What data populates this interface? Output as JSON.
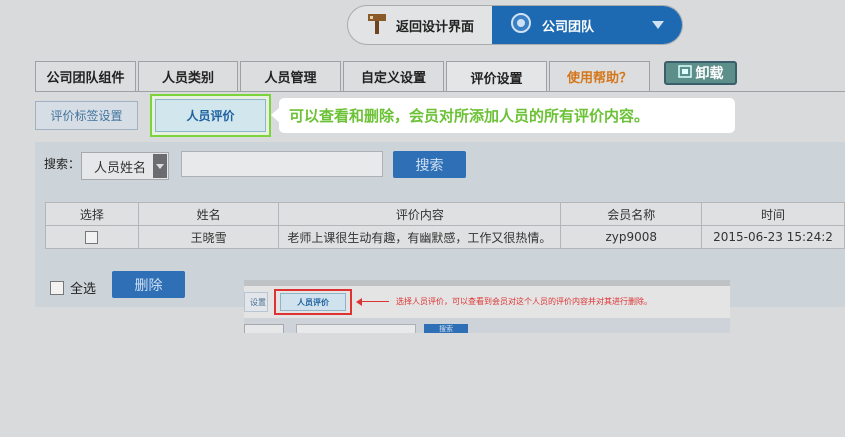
{
  "header": {
    "back_label": "返回设计界面",
    "team_label": "公司团队"
  },
  "tabs": [
    {
      "label": "公司团队组件"
    },
    {
      "label": "人员类别"
    },
    {
      "label": "人员管理"
    },
    {
      "label": "自定义设置"
    },
    {
      "label": "评价设置",
      "active": true
    },
    {
      "label": "使用帮助？"
    }
  ],
  "uninstall_label": "卸载",
  "subtabs": [
    {
      "label": "评价标签设置"
    },
    {
      "label": "人员评价",
      "active": true
    }
  ],
  "callout": "可以查看和删除，会员对所添加人员的所有评价内容。",
  "search": {
    "label": "搜索：",
    "field_value": "人员姓名",
    "input_value": "",
    "button_label": "搜索"
  },
  "table": {
    "headers": [
      "选择",
      "姓名",
      "评价内容",
      "会员名称",
      "时间"
    ],
    "rows": [
      {
        "name": "王晓雪",
        "content": "老师上课很生动有趣，有幽默感，工作又很热情。",
        "member": "zyp9008",
        "time": "2015-06-23 15:24:2"
      }
    ]
  },
  "footer": {
    "select_all_label": "全选",
    "delete_label": "删除"
  },
  "inset": {
    "subtab_label": "设置",
    "active_label": "人员评价",
    "note": "选择人员评价，可以查看到会员对这个人员的评价内容并对其进行删除。",
    "search_label": "搜索"
  },
  "colors": {
    "accent_blue": "#1d6ab2",
    "callout_green": "#6cc236",
    "highlight_red": "#dd3333"
  }
}
